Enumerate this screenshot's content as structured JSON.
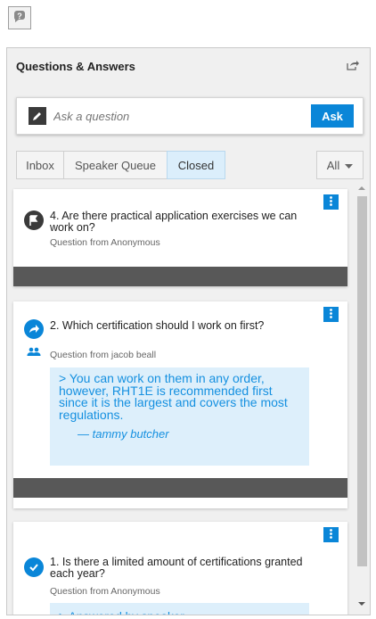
{
  "panel": {
    "title": "Questions & Answers"
  },
  "ask": {
    "placeholder": "Ask a question",
    "button_label": "Ask"
  },
  "tabs": [
    {
      "label": "Inbox",
      "active": false
    },
    {
      "label": "Speaker Queue",
      "active": false
    },
    {
      "label": "Closed",
      "active": true
    }
  ],
  "filter": {
    "value": "All"
  },
  "questions": [
    {
      "status_icon": "flag-icon",
      "text": "4. Are there practical application exercises we can work on?",
      "from": "Question from Anonymous"
    },
    {
      "status_icon": "forward-arrow-icon",
      "secondary_icon": "group-icon",
      "text": "2. Which certification should I work on first?",
      "from": "Question from jacob beall",
      "answer": {
        "text": "> You can work on them in any order, however, RHT1E is recommended first since it is the largest and covers the most regulations.",
        "author": "— tammy butcher"
      }
    },
    {
      "status_icon": "check-circle-icon",
      "text": "1. Is there a limited amount of certifications granted each year?",
      "from": "Question from Anonymous",
      "answered_label": ">  Answered by speaker"
    }
  ],
  "colors": {
    "accent": "#0a86d8",
    "answer_bg": "#ddeffb",
    "answer_text": "#1590e0",
    "card_bar": "#585858"
  }
}
